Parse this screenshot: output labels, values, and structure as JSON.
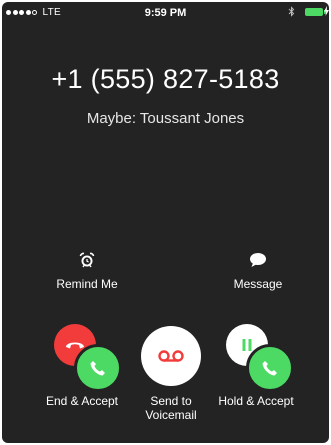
{
  "status_bar": {
    "carrier": "LTE",
    "time": "9:59 PM",
    "signal_bars_filled": 4,
    "signal_bars_total": 5,
    "battery_color": "#4cd964"
  },
  "call": {
    "number": "+1 (555) 827-5183",
    "caller_hint": "Maybe: Toussant Jones"
  },
  "actions": {
    "remind": {
      "label": "Remind Me",
      "icon": "alarm-clock-icon"
    },
    "message": {
      "label": "Message",
      "icon": "speech-bubble-icon"
    },
    "end_accept": {
      "label": "End & Accept",
      "icons": [
        "end-call-icon",
        "accept-call-icon"
      ]
    },
    "voicemail": {
      "label_line1": "Send to",
      "label_line2": "Voicemail",
      "icon": "voicemail-icon"
    },
    "hold_accept": {
      "label": "Hold & Accept",
      "icons": [
        "pause-icon",
        "accept-call-icon"
      ]
    }
  },
  "colors": {
    "background": "#232323",
    "decline_red": "#f23c3c",
    "accept_green": "#4cd964",
    "voicemail_red": "#f23c3c"
  }
}
